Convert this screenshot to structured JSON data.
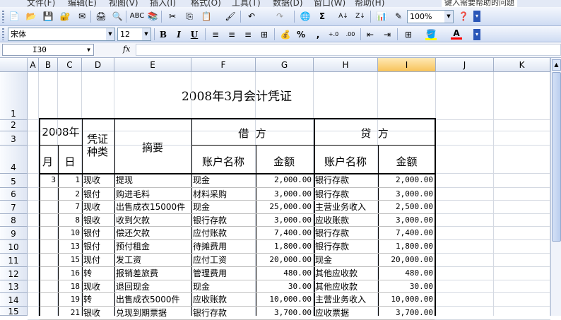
{
  "menubar": [
    "文件(F)",
    "编辑(E)",
    "视图(V)",
    "插入(I)",
    "格式(O)",
    "工具(T)",
    "数据(D)",
    "窗口(W)",
    "帮助(H)",
    "键入需要帮助的问题"
  ],
  "toolbar": {
    "zoom": "100%",
    "font_name": "宋体",
    "font_size": "12",
    "bold": "B",
    "italic": "I",
    "underline": "U",
    "percent": "%",
    "comma": ",",
    "sum": "Σ",
    "font_color_glyph": "A"
  },
  "formula_bar": {
    "name_box": "I30",
    "fx": "fx",
    "content": ""
  },
  "columns": [
    "A",
    "B",
    "C",
    "D",
    "E",
    "F",
    "G",
    "H",
    "I",
    "J",
    "K"
  ],
  "selected_column": "I",
  "row_numbers": [
    "1",
    "2",
    "3",
    "4",
    "5",
    "6",
    "7",
    "8",
    "9",
    "10",
    "11",
    "12",
    "13",
    "14",
    "15"
  ],
  "sheet": {
    "title": "2008年3月会计凭证",
    "header": {
      "year": "2008年",
      "month": "月",
      "day": "日",
      "voucher_type": "凭证种类",
      "summary": "摘要",
      "debit": "借  方",
      "credit": "贷  方",
      "account_name": "账户名称",
      "amount": "金额"
    },
    "rows": [
      {
        "month": "3",
        "day": "1",
        "type": "现收",
        "summary": "提现",
        "debit_acct": "现金",
        "debit_amt": "2,000.00",
        "credit_acct": "银行存款",
        "credit_amt": "2,000.00"
      },
      {
        "month": "",
        "day": "2",
        "type": "银付",
        "summary": "购进毛料",
        "debit_acct": "材料采购",
        "debit_amt": "3,000.00",
        "credit_acct": "银行存款",
        "credit_amt": "3,000.00"
      },
      {
        "month": "",
        "day": "7",
        "type": "现收",
        "summary": "出售成衣15000件",
        "debit_acct": "现金",
        "debit_amt": "25,000.00",
        "credit_acct": "主营业务收入",
        "credit_amt": "2,500.00"
      },
      {
        "month": "",
        "day": "8",
        "type": "银收",
        "summary": "收到欠款",
        "debit_acct": "银行存款",
        "debit_amt": "3,000.00",
        "credit_acct": "应收账款",
        "credit_amt": "3,000.00"
      },
      {
        "month": "",
        "day": "10",
        "type": "银付",
        "summary": "偿还欠款",
        "debit_acct": "应付账款",
        "debit_amt": "7,400.00",
        "credit_acct": "银行存款",
        "credit_amt": "7,400.00"
      },
      {
        "month": "",
        "day": "13",
        "type": "银付",
        "summary": "预付租金",
        "debit_acct": "待摊费用",
        "debit_amt": "1,800.00",
        "credit_acct": "银行存款",
        "credit_amt": "1,800.00"
      },
      {
        "month": "",
        "day": "15",
        "type": "现付",
        "summary": "发工资",
        "debit_acct": "应付工资",
        "debit_amt": "20,000.00",
        "credit_acct": "现金",
        "credit_amt": "20,000.00"
      },
      {
        "month": "",
        "day": "16",
        "type": "转",
        "summary": "报销差旅费",
        "debit_acct": "管理费用",
        "debit_amt": "480.00",
        "credit_acct": "其他应收款",
        "credit_amt": "480.00"
      },
      {
        "month": "",
        "day": "18",
        "type": "现收",
        "summary": "退回现金",
        "debit_acct": "现金",
        "debit_amt": "30.00",
        "credit_acct": "其他应收款",
        "credit_amt": "30.00"
      },
      {
        "month": "",
        "day": "19",
        "type": "转",
        "summary": "出售成衣5000件",
        "debit_acct": "应收账款",
        "debit_amt": "10,000.00",
        "credit_acct": "主营业务收入",
        "credit_amt": "10,000.00"
      },
      {
        "month": "",
        "day": "21",
        "type": "银收",
        "summary": "兑现到期票据",
        "debit_acct": "银行存款",
        "debit_amt": "3,700.00",
        "credit_acct": "应收票据",
        "credit_amt": "3,700.00"
      }
    ]
  }
}
